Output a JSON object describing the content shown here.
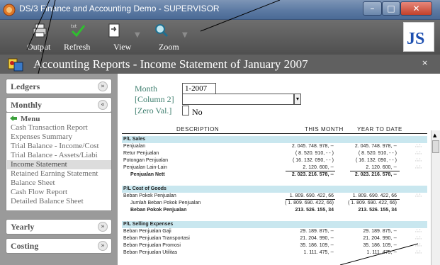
{
  "window": {
    "title": "DS/3 Finance and Accounting Demo - SUPERVISOR",
    "minimize": "–",
    "maximize": "□",
    "close": "✕"
  },
  "toolbar": {
    "output_label": "Output",
    "refresh_label": "Refresh",
    "view_label": "View",
    "zoom_label": "Zoom",
    "arrow": "▼",
    "icons": [
      "printer-icon",
      "refresh-check-icon",
      "view-document-icon",
      "zoom-magnifier-icon"
    ],
    "logo_text": "JS"
  },
  "header": {
    "title": "Accounting Reports - Income Statement of January 2007",
    "close": "×"
  },
  "sidebar": {
    "sections": [
      {
        "label": "Ledgers",
        "chevron": "»"
      },
      {
        "label": "Monthly",
        "chevron": "«"
      },
      {
        "label": "Yearly",
        "chevron": "»"
      },
      {
        "label": "Costing",
        "chevron": "»"
      }
    ],
    "menu_title": "Menu",
    "menu_items": [
      "Cash Transaction Report",
      "Expenses Summary",
      "Trial Balance - Income/Cost",
      "Trial Balance - Assets/Liabi",
      "Income Statement",
      "Retained Earning Statement",
      "Balance Sheet",
      "Cash Flow Report",
      "Detailed Balance Sheet"
    ],
    "selected_index": 4
  },
  "params": {
    "month_label": "Month",
    "month_value": "1-2007",
    "column2_label": "[Column 2]",
    "column2_value": "",
    "combo_arrow": "▾",
    "zero_label": "[Zero Val.]",
    "zero_value": "No"
  },
  "report": {
    "headers": {
      "description": "DESCRIPTION",
      "this_month": "THIS MONTH",
      "year_to_date": "YEAR TO DATE"
    },
    "rows": [
      {
        "type": "section",
        "desc": "P/L Sales",
        "tm": "",
        "ytd": "",
        "dots": ""
      },
      {
        "type": "normal",
        "desc": "Penjualan",
        "tm": "2. 045. 748. 978, --",
        "ytd": "2. 045. 748. 978, --",
        "dots": "∴∴"
      },
      {
        "type": "normal",
        "desc": "Retur Penjualan",
        "tm": "( 8. 520. 910, - - )",
        "ytd": "( 8. 520. 910, - - )",
        "dots": "∴∴"
      },
      {
        "type": "normal",
        "desc": "Potongan Penjualan",
        "tm": "( 16. 132. 090, - - )",
        "ytd": "( 16. 132. 090, - - )",
        "dots": "∴∴"
      },
      {
        "type": "normal",
        "desc": "Penjualan Lain-Lain",
        "tm": "2. 120. 600, --",
        "ytd": "2. 120. 600, --",
        "dots": "∴∴"
      },
      {
        "type": "bold-indent",
        "desc": "Penjualan Nett",
        "tm": "2. 023. 216. 578, --",
        "ytd": "2. 023. 216. 578, --",
        "dots": ""
      },
      {
        "type": "blank",
        "desc": "",
        "tm": "",
        "ytd": "",
        "dots": ""
      },
      {
        "type": "section",
        "desc": "P/L Cost of Goods",
        "tm": "",
        "ytd": "",
        "dots": ""
      },
      {
        "type": "normal",
        "desc": "Beban Pokok Penjualan",
        "tm": "1. 809. 690. 422, 66",
        "ytd": "1. 809. 690. 422, 66",
        "dots": "∴∴"
      },
      {
        "type": "indent",
        "desc": "Jumlah Beban Pokok Penjualan",
        "tm": "( 1. 809. 690. 422, 66)",
        "ytd": "( 1. 809. 690. 422, 66)",
        "dots": ""
      },
      {
        "type": "bold-indent",
        "desc": "Beban Pokok Penjualan",
        "tm": "213. 526. 155, 34",
        "ytd": "213. 526. 155, 34",
        "dots": ""
      },
      {
        "type": "blank",
        "desc": "",
        "tm": "",
        "ytd": "",
        "dots": ""
      },
      {
        "type": "section",
        "desc": "P/L Selling Expenses",
        "tm": "",
        "ytd": "",
        "dots": ""
      },
      {
        "type": "normal",
        "desc": "Beban Penjualan Gaji",
        "tm": "29. 189. 875, --",
        "ytd": "29. 189. 875, --",
        "dots": "∴∴"
      },
      {
        "type": "normal",
        "desc": "Beban Penjualan Transportasi",
        "tm": "21. 204. 990, --",
        "ytd": "21. 204. 990, --",
        "dots": "∴∴"
      },
      {
        "type": "normal",
        "desc": "Beban Penjualan Promosi",
        "tm": "35. 186. 109, --",
        "ytd": "35. 186. 109, --",
        "dots": "∴∴"
      },
      {
        "type": "normal",
        "desc": "Beban Penjualan Utilitas",
        "tm": "1. 111. 475, --",
        "ytd": "1. 111. 475, --",
        "dots": "∴∴"
      }
    ]
  }
}
